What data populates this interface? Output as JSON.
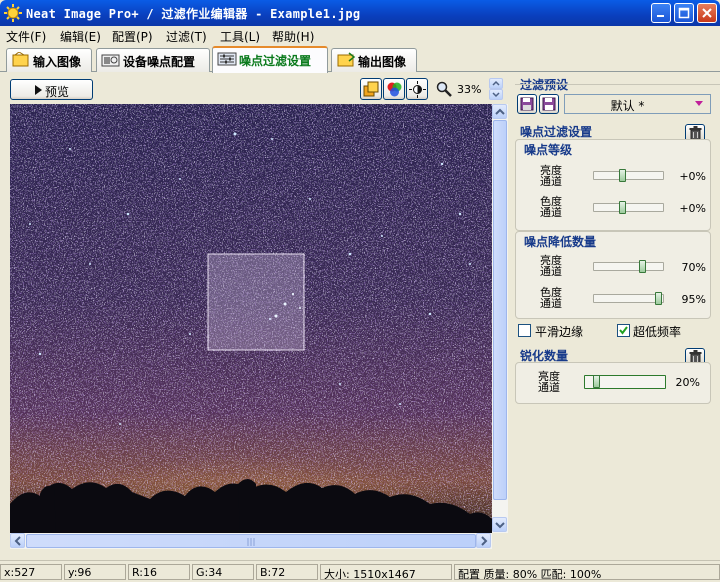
{
  "window": {
    "title": "Neat Image Pro+ / 过滤作业编辑器 - Example1.jpg"
  },
  "menu": [
    "文件(F)",
    "编辑(E)",
    "配置(P)",
    "过滤(T)",
    "工具(L)",
    "帮助(H)"
  ],
  "tabs": [
    {
      "label": "输入图像",
      "icon": "input-image-icon"
    },
    {
      "label": "设备噪点配置",
      "icon": "device-noise-icon"
    },
    {
      "label": "噪点过滤设置",
      "icon": "filter-settings-icon",
      "active": true
    },
    {
      "label": "输出图像",
      "icon": "output-image-icon"
    }
  ],
  "toolbar": {
    "preview_label": "预览",
    "zoom": "33%"
  },
  "preset": {
    "header": "过滤预设",
    "selected": "默认 *"
  },
  "noise_filter": {
    "header": "噪点过滤设置",
    "level_header": "噪点等级",
    "level": [
      {
        "label1": "亮度",
        "label2": "通道",
        "value": "+0%",
        "pos": 0.45
      },
      {
        "label1": "色度",
        "label2": "通道",
        "value": "+0%",
        "pos": 0.45
      }
    ],
    "reduction_header": "噪点降低数量",
    "reduction": [
      {
        "label1": "亮度",
        "label2": "通道",
        "value": "70%",
        "pos": 0.7
      },
      {
        "label1": "色度",
        "label2": "通道",
        "value": "95%",
        "pos": 0.95
      }
    ],
    "smooth_edges": "平滑边缘",
    "smooth_checked": false,
    "ultra_low": "超低频率",
    "ultra_checked": true
  },
  "sharpen": {
    "header": "锐化数量",
    "label1": "亮度",
    "label2": "通道",
    "value": "20%",
    "pos": 0.2
  },
  "status": {
    "x": "x:527",
    "y": "y:96",
    "r": "R:16",
    "g": "G:34",
    "b": "B:72",
    "size": "大小: 1510x1467",
    "config": "配置 质量: 80% 匹配: 100%"
  },
  "colors": {
    "accent": "#0a5ce6",
    "active_tab_text": "#0a7a1c",
    "section_text": "#173a8a",
    "slider_knob": "#38783a"
  }
}
